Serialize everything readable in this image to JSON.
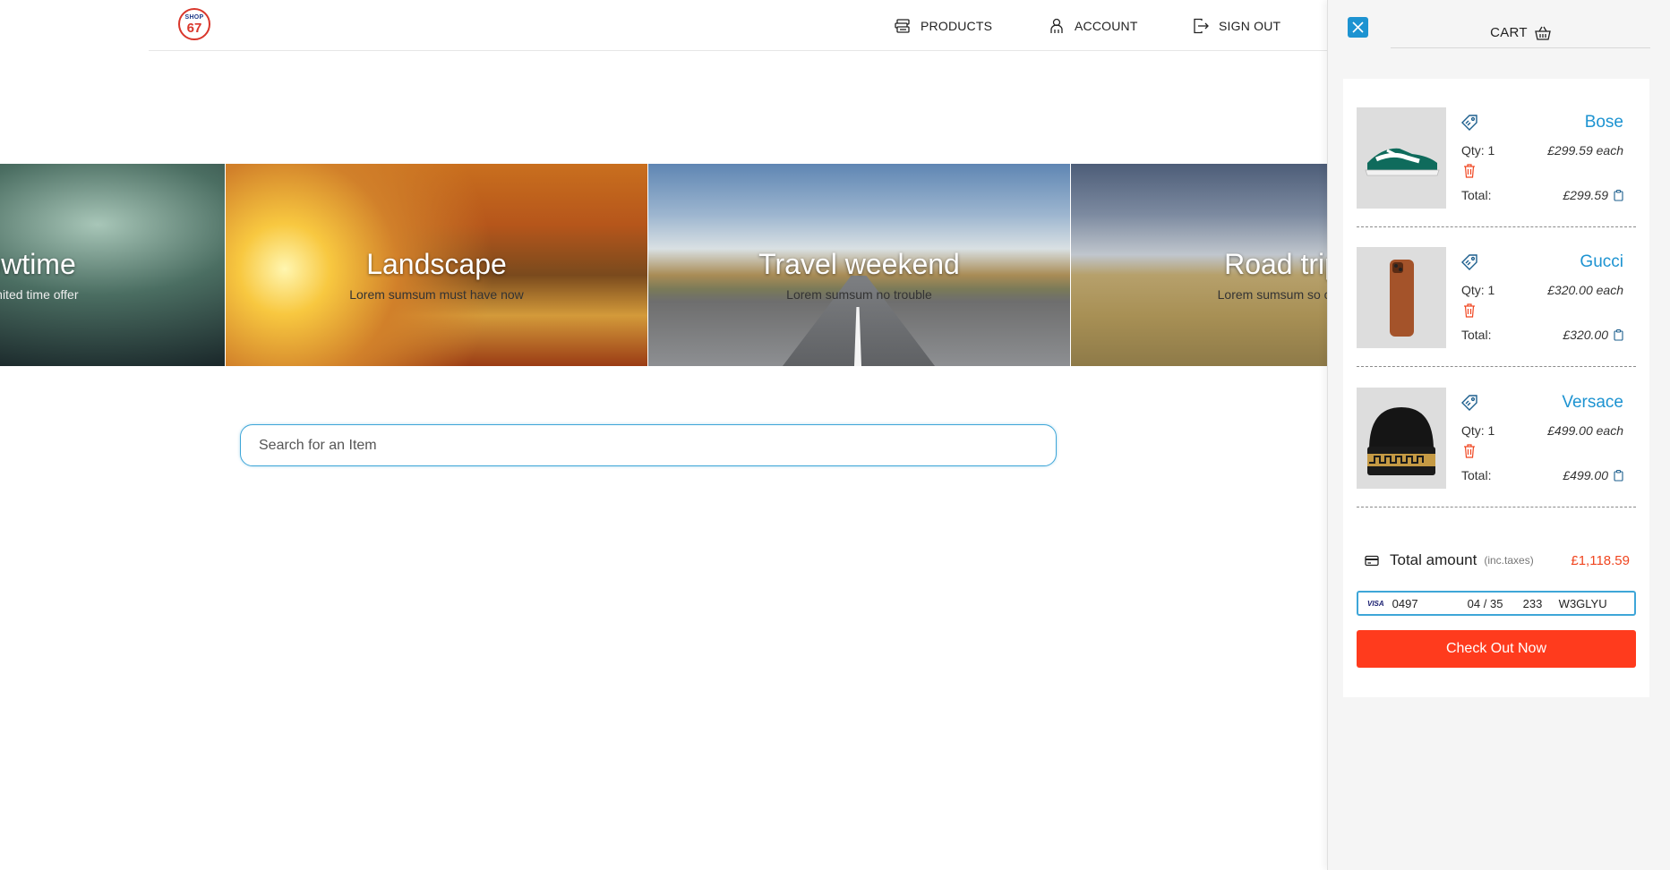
{
  "header": {
    "logo": {
      "line1": "SHOP",
      "line2": "67"
    },
    "nav": [
      {
        "label": "PRODUCTS",
        "icon": "products-icon"
      },
      {
        "label": "ACCOUNT",
        "icon": "user-icon"
      },
      {
        "label": "SIGN OUT",
        "icon": "sign-out-icon"
      }
    ]
  },
  "banner": {
    "slides": [
      {
        "title": "Showtime",
        "subtitle": "Lorem limited time offer"
      },
      {
        "title": "Landscape",
        "subtitle": "Lorem sumsum must have now"
      },
      {
        "title": "Travel weekend",
        "subtitle": "Lorem sumsum no trouble"
      },
      {
        "title": "Road trip",
        "subtitle": "Lorem sumsum so cool"
      }
    ]
  },
  "search": {
    "placeholder": "Search for an Item"
  },
  "cart": {
    "title": "CART",
    "items": [
      {
        "brand": "Bose",
        "qty_label": "Qty: 1",
        "each": "£299.59 each",
        "total_label": "Total:",
        "total": "£299.59",
        "product": "sneaker"
      },
      {
        "brand": "Gucci",
        "qty_label": "Qty: 1",
        "each": "£320.00 each",
        "total_label": "Total:",
        "total": "£320.00",
        "product": "phone-case"
      },
      {
        "brand": "Versace",
        "qty_label": "Qty: 1",
        "each": "£499.00 each",
        "total_label": "Total:",
        "total": "£499.00",
        "product": "beanie"
      }
    ],
    "total_label": "Total amount",
    "total_note": "(inc.taxes)",
    "total_amount": "£1,118.59",
    "payment": {
      "brand": "VISA",
      "number": "0497",
      "expiry": "04 / 35",
      "cvc": "233",
      "postcode": "W3GLYU"
    },
    "checkout_label": "Check Out Now"
  },
  "colors": {
    "accent": "#1d93d1",
    "checkout": "#ff3b1d",
    "total": "#f0451f"
  }
}
